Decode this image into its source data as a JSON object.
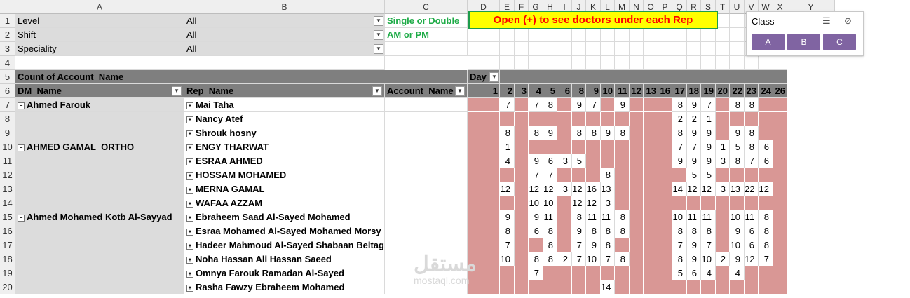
{
  "columns": [
    {
      "label": "A",
      "w": 241
    },
    {
      "label": "B",
      "w": 286
    },
    {
      "label": "C",
      "w": 118
    },
    {
      "label": "D",
      "w": 46
    },
    {
      "label": "E",
      "w": 21
    },
    {
      "label": "F",
      "w": 20
    },
    {
      "label": "G",
      "w": 21
    },
    {
      "label": "H",
      "w": 20
    },
    {
      "label": "I",
      "w": 21
    },
    {
      "label": "J",
      "w": 20
    },
    {
      "label": "K",
      "w": 21
    },
    {
      "label": "L",
      "w": 20
    },
    {
      "label": "M",
      "w": 21
    },
    {
      "label": "N",
      "w": 20
    },
    {
      "label": "O",
      "w": 21
    },
    {
      "label": "P",
      "w": 20
    },
    {
      "label": "Q",
      "w": 21
    },
    {
      "label": "R",
      "w": 20
    },
    {
      "label": "S",
      "w": 21
    },
    {
      "label": "T",
      "w": 20
    },
    {
      "label": "U",
      "w": 21
    },
    {
      "label": "V",
      "w": 20
    },
    {
      "label": "W",
      "w": 21
    },
    {
      "label": "X",
      "w": 20
    },
    {
      "label": "Y",
      "w": 68
    }
  ],
  "row_numbers": [
    "1",
    "2",
    "3",
    "4",
    "5",
    "6",
    "7",
    "8",
    "9",
    "10",
    "11",
    "12",
    "13",
    "14",
    "15",
    "16",
    "17",
    "18",
    "19",
    "20"
  ],
  "filters": [
    {
      "label": "Level",
      "value": "All",
      "note": "Single or Double"
    },
    {
      "label": "Shift",
      "value": "All",
      "note": "AM or PM"
    },
    {
      "label": "Speciality",
      "value": "All",
      "note": ""
    }
  ],
  "banner": "Open (+) to see doctors under each Rep",
  "slicer": {
    "title": "Class",
    "buttons": [
      "A",
      "B",
      "C"
    ]
  },
  "pivot": {
    "value_label": "Count of Account_Name",
    "col_field": "Day",
    "row_fields": [
      "DM_Name",
      "Rep_Name",
      "Account_Name"
    ],
    "days": [
      "1",
      "2",
      "3",
      "4",
      "5",
      "6",
      "8",
      "9",
      "10",
      "11",
      "12",
      "13",
      "16",
      "17",
      "18",
      "19",
      "20",
      "22",
      "23",
      "24",
      "26"
    ]
  },
  "rows": [
    {
      "dm": "Ahmed Farouk",
      "rep": "Mai Taha",
      "vals": [
        "",
        "7",
        "",
        "7",
        "8",
        "",
        "9",
        "7",
        "",
        "9",
        "",
        "",
        "",
        "8",
        "9",
        "7",
        "",
        "8",
        "8",
        "",
        ""
      ]
    },
    {
      "dm": "",
      "rep": "Nancy Atef",
      "vals": [
        "",
        "",
        "",
        "",
        "",
        "",
        "",
        "",
        "",
        "",
        "",
        "",
        "",
        "2",
        "2",
        "1",
        "",
        "",
        "",
        "",
        ""
      ]
    },
    {
      "dm": "",
      "rep": "Shrouk hosny",
      "vals": [
        "",
        "8",
        "",
        "8",
        "9",
        "",
        "8",
        "8",
        "9",
        "8",
        "",
        "",
        "",
        "8",
        "9",
        "9",
        "",
        "9",
        "8",
        "",
        ""
      ]
    },
    {
      "dm": "AHMED GAMAL_ORTHO",
      "rep": "ENGY THARWAT",
      "vals": [
        "",
        "1",
        "",
        "",
        "",
        "",
        "",
        "",
        "",
        "",
        "",
        "",
        "",
        "7",
        "7",
        "9",
        "1",
        "5",
        "8",
        "6",
        ""
      ]
    },
    {
      "dm": "",
      "rep": "ESRAA AHMED",
      "vals": [
        "",
        "4",
        "",
        "9",
        "6",
        "3",
        "5",
        "",
        "",
        "",
        "",
        "",
        "",
        "9",
        "9",
        "9",
        "3",
        "8",
        "7",
        "6",
        ""
      ]
    },
    {
      "dm": "",
      "rep": "HOSSAM MOHAMED",
      "vals": [
        "",
        "",
        "",
        "7",
        "7",
        "",
        "",
        "",
        "8",
        "",
        "",
        "",
        "",
        "",
        "5",
        "5",
        "",
        "",
        "",
        "",
        ""
      ]
    },
    {
      "dm": "",
      "rep": "MERNA GAMAL",
      "vals": [
        "",
        "12",
        "",
        "12",
        "12",
        "3",
        "12",
        "16",
        "13",
        "",
        "",
        "",
        "",
        "14",
        "12",
        "12",
        "3",
        "13",
        "22",
        "12",
        ""
      ]
    },
    {
      "dm": "",
      "rep": "WAFAA AZZAM",
      "vals": [
        "",
        "",
        "",
        "10",
        "10",
        "",
        "12",
        "12",
        "3",
        "",
        "",
        "",
        "",
        "",
        "",
        "",
        "",
        "",
        "",
        "",
        ""
      ]
    },
    {
      "dm": "Ahmed Mohamed Kotb Al-Sayyad",
      "rep": "Ebraheem Saad Al-Sayed Mohamed",
      "vals": [
        "",
        "9",
        "",
        "9",
        "11",
        "",
        "8",
        "11",
        "11",
        "8",
        "",
        "",
        "",
        "10",
        "11",
        "11",
        "",
        "10",
        "11",
        "8",
        ""
      ]
    },
    {
      "dm": "",
      "rep": "Esraa Mohamed Al-Sayed Mohamed Morsy",
      "vals": [
        "",
        "8",
        "",
        "6",
        "8",
        "",
        "9",
        "8",
        "8",
        "8",
        "",
        "",
        "",
        "8",
        "8",
        "8",
        "",
        "9",
        "6",
        "8",
        ""
      ]
    },
    {
      "dm": "",
      "rep": "Hadeer Mahmoud Al-Sayed Shabaan Beltagy",
      "vals": [
        "",
        "7",
        "",
        "",
        "8",
        "",
        "7",
        "9",
        "8",
        "",
        "",
        "",
        "",
        "7",
        "9",
        "7",
        "",
        "10",
        "6",
        "8",
        ""
      ]
    },
    {
      "dm": "",
      "rep": "Noha Hassan Ali Hassan Saeed",
      "vals": [
        "",
        "10",
        "",
        "8",
        "8",
        "2",
        "7",
        "10",
        "7",
        "8",
        "",
        "",
        "",
        "8",
        "9",
        "10",
        "2",
        "9",
        "12",
        "7",
        ""
      ]
    },
    {
      "dm": "",
      "rep": "Omnya Farouk Ramadan Al-Sayed",
      "vals": [
        "",
        "",
        "",
        "7",
        "",
        "",
        "",
        "",
        "",
        "",
        "",
        "",
        "",
        "5",
        "6",
        "4",
        "",
        "4",
        "",
        "",
        ""
      ]
    },
    {
      "dm": "",
      "rep": "Rasha Fawzy Ebraheem Mohamed",
      "vals": [
        "",
        "",
        "",
        "",
        "",
        "",
        "",
        "",
        "14",
        "",
        "",
        "",
        "",
        "",
        "",
        "",
        "",
        "",
        "",
        "",
        ""
      ]
    }
  ],
  "watermark": "مستقل",
  "watermark_sub": "mostaql.com",
  "colors": {
    "pivot_header": "#7f7f7f",
    "filter_bg": "#dcdcdc",
    "empty_cell": "#d99795",
    "banner_bg": "#ffff00",
    "banner_text": "#ff0000",
    "note_text": "#1eab47",
    "slicer_button": "#8064a2"
  }
}
